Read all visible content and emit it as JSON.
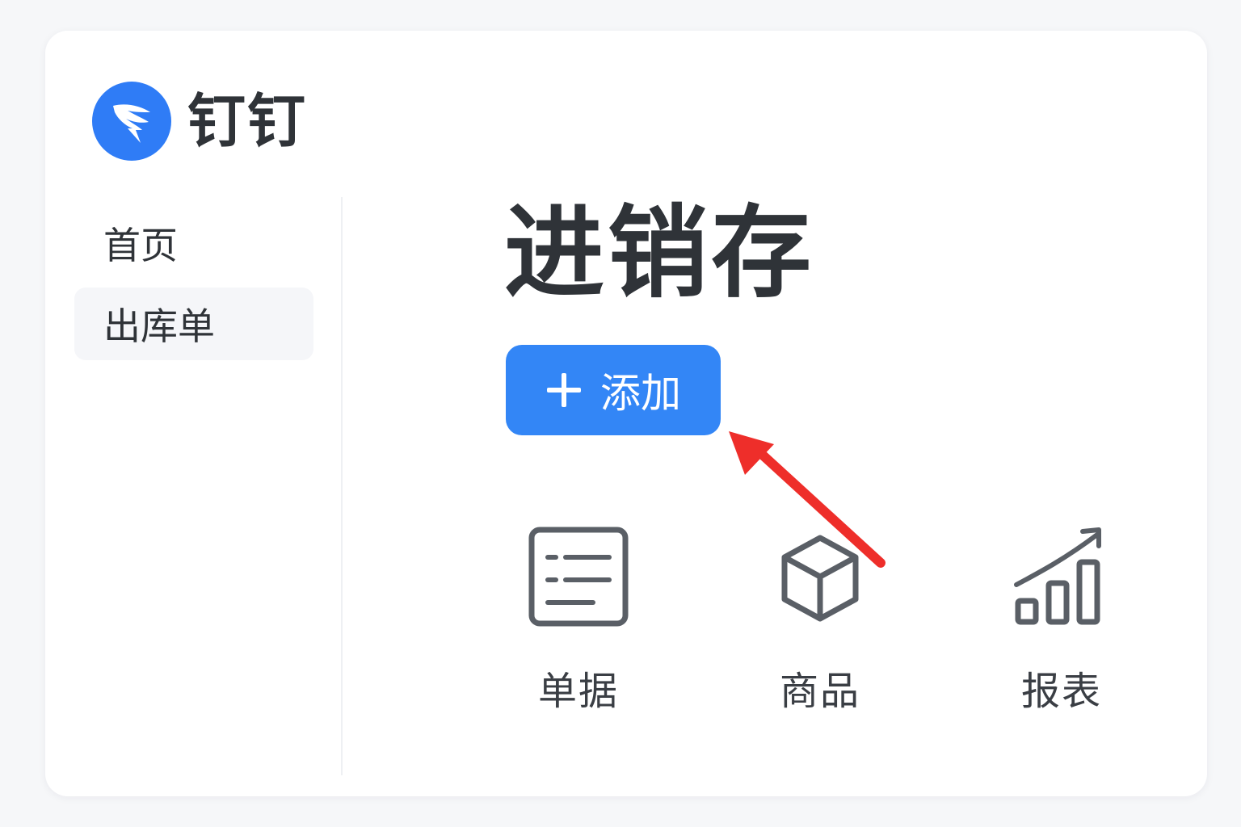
{
  "app": {
    "brand_name": "钉钉",
    "brand_color": "#2f7cf6",
    "logo_icon": "dingtalk-wing-icon"
  },
  "sidebar": {
    "items": [
      {
        "label": "首页",
        "selected": false
      },
      {
        "label": "出库单",
        "selected": true
      }
    ]
  },
  "main": {
    "title": "进销存",
    "add_button": {
      "label": "添加",
      "icon": "plus-icon",
      "color": "#3386f6"
    },
    "features": [
      {
        "label": "单据",
        "icon": "document-list-icon"
      },
      {
        "label": "商品",
        "icon": "box-icon"
      },
      {
        "label": "报表",
        "icon": "bar-chart-trend-icon"
      }
    ]
  },
  "annotation": {
    "arrow_color": "#ee2e2a",
    "arrow_icon": "red-pointer-arrow-icon"
  }
}
